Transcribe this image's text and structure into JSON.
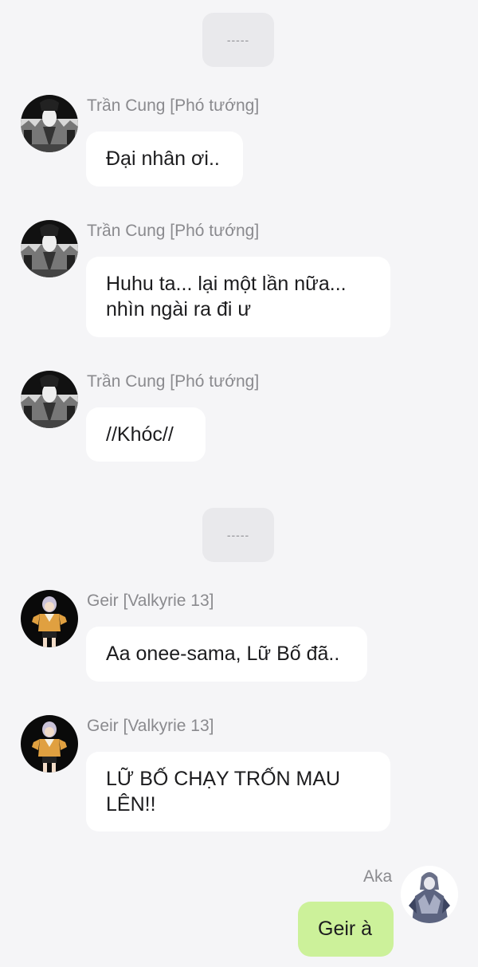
{
  "chat": {
    "divider_top": "-----",
    "divider_mid": "-----",
    "messages": [
      {
        "sender": "Trần Cung [Phó tướng]",
        "text": "Đại nhân ơi..",
        "avatar": "tran-cung-avatar"
      },
      {
        "sender": "Trần Cung [Phó tướng]",
        "text": "Huhu ta... lại một lần nữa...\nnhìn ngài ra đi ư",
        "avatar": "tran-cung-avatar"
      },
      {
        "sender": "Trần Cung [Phó tướng]",
        "text": "//Khóc//",
        "avatar": "tran-cung-avatar"
      },
      {
        "sender": "Geir [Valkyrie 13]",
        "text": "Aa onee-sama, Lữ Bố đã..",
        "avatar": "geir-avatar"
      },
      {
        "sender": "Geir [Valkyrie 13]",
        "text": "LỮ BỐ CHẠY TRỐN MAU\nLÊN!!",
        "avatar": "geir-avatar"
      },
      {
        "sender": "Aka",
        "text": "Geir à",
        "avatar": "aka-avatar",
        "own": true
      }
    ]
  },
  "colors": {
    "background": "#f5f5f7",
    "bubble_incoming": "#ffffff",
    "bubble_outgoing": "#ccf19a",
    "sender_text": "#8a8a8e"
  }
}
